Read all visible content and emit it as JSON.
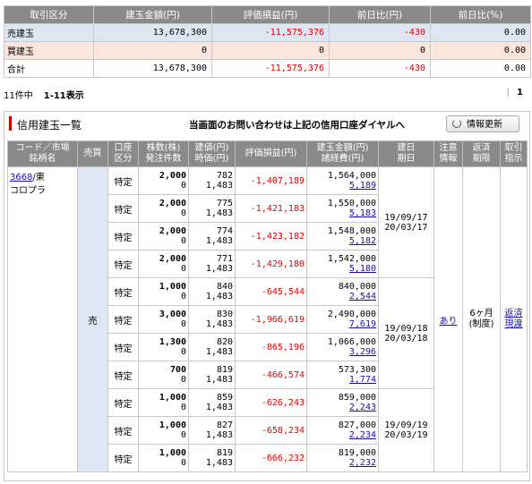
{
  "summary": {
    "headers": [
      "取引区分",
      "建玉金額(円)",
      "評価損益(円)",
      "前日比(円)",
      "前日比(%)"
    ],
    "rows": [
      {
        "label": "売建玉",
        "amount": "13,678,300",
        "pl": "-11,575,376",
        "diff": "-430",
        "pct": "0.00"
      },
      {
        "label": "買建玉",
        "amount": "0",
        "pl": "0",
        "diff": "0",
        "pct": "0.00"
      },
      {
        "label": "合計",
        "amount": "13,678,300",
        "pl": "-11,575,376",
        "diff": "-430",
        "pct": "0.00"
      }
    ]
  },
  "countbar": {
    "count": "11件中",
    "range": "1-11表示",
    "page": "1"
  },
  "panel": {
    "title": "信用建玉一覧",
    "notice": "当画面のお問い合わせは上記の信用口座ダイヤルへ",
    "refresh_label": "情報更新"
  },
  "detail": {
    "headers": {
      "code": [
        "コード／市場",
        "銘柄名"
      ],
      "side": [
        "売買"
      ],
      "acct": [
        "口座",
        "区分"
      ],
      "qty": [
        "株数(株)",
        "発注件数"
      ],
      "price": [
        "建値(円)",
        "時価(円)"
      ],
      "pl": [
        "評価損益(円)"
      ],
      "amount": [
        "建玉金額(円)",
        "諸経費(円)"
      ],
      "dates": [
        "建日",
        "期日"
      ],
      "caution": [
        "注意",
        "情報"
      ],
      "period": [
        "返済",
        "期限"
      ],
      "action": [
        "取引",
        "指示"
      ]
    },
    "stock": {
      "code": "3668",
      "market": "/東",
      "name": "コロプラ"
    },
    "side": "売",
    "caution": "あり",
    "period_line1": "6ヶ月",
    "period_line2": "(制度)",
    "action_line1": "返済",
    "action_line2": "現渡",
    "date_groups": [
      {
        "build": "19/09/17",
        "due": "20/03/17"
      },
      {
        "build": "19/09/18",
        "due": "20/03/18"
      },
      {
        "build": "19/09/19",
        "due": "20/03/19"
      }
    ],
    "rows": [
      {
        "acct": "特定",
        "qty": "2,000",
        "orders": "0",
        "price": "782",
        "market": "1,483",
        "pl": "-1,407,189",
        "amount": "1,564,000",
        "cost": "5,189"
      },
      {
        "acct": "特定",
        "qty": "2,000",
        "orders": "0",
        "price": "775",
        "market": "1,483",
        "pl": "-1,421,183",
        "amount": "1,550,000",
        "cost": "5,183"
      },
      {
        "acct": "特定",
        "qty": "2,000",
        "orders": "0",
        "price": "774",
        "market": "1,483",
        "pl": "-1,423,182",
        "amount": "1,548,000",
        "cost": "5,182"
      },
      {
        "acct": "特定",
        "qty": "2,000",
        "orders": "0",
        "price": "771",
        "market": "1,483",
        "pl": "-1,429,180",
        "amount": "1,542,000",
        "cost": "5,180"
      },
      {
        "acct": "特定",
        "qty": "1,000",
        "orders": "0",
        "price": "840",
        "market": "1,483",
        "pl": "-645,544",
        "amount": "840,000",
        "cost": "2,544"
      },
      {
        "acct": "特定",
        "qty": "3,000",
        "orders": "0",
        "price": "830",
        "market": "1,483",
        "pl": "-1,966,619",
        "amount": "2,490,000",
        "cost": "7,619"
      },
      {
        "acct": "特定",
        "qty": "1,300",
        "orders": "0",
        "price": "820",
        "market": "1,483",
        "pl": "-865,196",
        "amount": "1,066,000",
        "cost": "3,296"
      },
      {
        "acct": "特定",
        "qty": "700",
        "orders": "0",
        "price": "819",
        "market": "1,483",
        "pl": "-466,574",
        "amount": "573,300",
        "cost": "1,774"
      },
      {
        "acct": "特定",
        "qty": "1,000",
        "orders": "0",
        "price": "859",
        "market": "1,483",
        "pl": "-626,243",
        "amount": "859,000",
        "cost": "2,243"
      },
      {
        "acct": "特定",
        "qty": "1,000",
        "orders": "0",
        "price": "827",
        "market": "1,483",
        "pl": "-658,234",
        "amount": "827,000",
        "cost": "2,234"
      },
      {
        "acct": "特定",
        "qty": "1,000",
        "orders": "0",
        "price": "819",
        "market": "1,483",
        "pl": "-666,232",
        "amount": "819,000",
        "cost": "2,232"
      }
    ]
  },
  "colors": {
    "header_bg": "#8a8a8a",
    "sell_bg": "#dde7f3",
    "buy_bg": "#fbe6dc",
    "loss": "#e00000",
    "link": "#1a0dab",
    "accent": "#cc0000"
  }
}
